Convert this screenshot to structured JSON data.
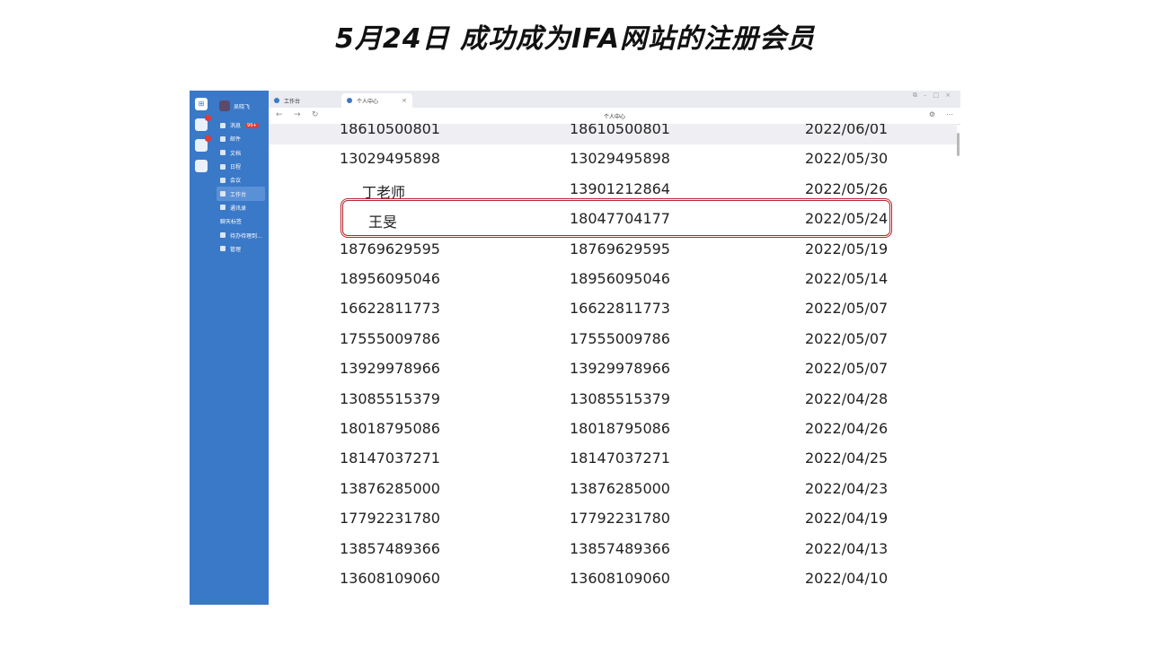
{
  "slide_title": "5月24日 成功成为IFA网站的注册会员",
  "sidebar": {
    "user_name": "吴晓飞",
    "nav_items": [
      {
        "label": "消息",
        "badge": "99+"
      },
      {
        "label": "邮件"
      },
      {
        "label": "文档"
      },
      {
        "label": "日程"
      },
      {
        "label": "会议"
      },
      {
        "label": "工作台",
        "active": true
      },
      {
        "label": "通讯录"
      },
      {
        "label": "聊天标签"
      },
      {
        "label": "待办待理到..."
      },
      {
        "label": "管理"
      }
    ]
  },
  "browser": {
    "tabs": [
      {
        "label": "工作台"
      },
      {
        "label": "个人中心",
        "active": true
      }
    ],
    "page_title": "个人中心"
  },
  "table": {
    "rows": [
      {
        "name": "18610500801",
        "phone": "18610500801",
        "date": "2022/06/01"
      },
      {
        "name": "13029495898",
        "phone": "13029495898",
        "date": "2022/05/30"
      },
      {
        "name": "丁老师",
        "phone": "13901212864",
        "date": "2022/05/26"
      },
      {
        "name": "王旻",
        "phone": "18047704177",
        "date": "2022/05/24",
        "highlighted": true
      },
      {
        "name": "18769629595",
        "phone": "18769629595",
        "date": "2022/05/19"
      },
      {
        "name": "18956095046",
        "phone": "18956095046",
        "date": "2022/05/14"
      },
      {
        "name": "16622811773",
        "phone": "16622811773",
        "date": "2022/05/07"
      },
      {
        "name": "17555009786",
        "phone": "17555009786",
        "date": "2022/05/07"
      },
      {
        "name": "13929978966",
        "phone": "13929978966",
        "date": "2022/05/07"
      },
      {
        "name": "13085515379",
        "phone": "13085515379",
        "date": "2022/04/28"
      },
      {
        "name": "18018795086",
        "phone": "18018795086",
        "date": "2022/04/26"
      },
      {
        "name": "18147037271",
        "phone": "18147037271",
        "date": "2022/04/25"
      },
      {
        "name": "13876285000",
        "phone": "13876285000",
        "date": "2022/04/23"
      },
      {
        "name": "17792231780",
        "phone": "17792231780",
        "date": "2022/04/19"
      },
      {
        "name": "13857489366",
        "phone": "13857489366",
        "date": "2022/04/13"
      },
      {
        "name": "13608109060",
        "phone": "13608109060",
        "date": "2022/04/10"
      }
    ]
  },
  "colors": {
    "sidebar": "#3a78c8",
    "highlight_border": "#b3262b"
  }
}
